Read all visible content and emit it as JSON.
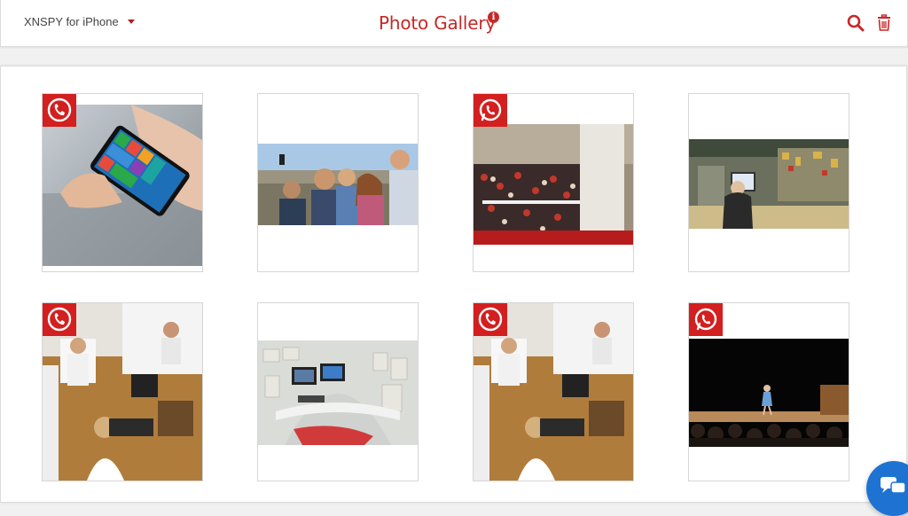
{
  "header": {
    "device_label": "XNSPY for iPhone",
    "title": "Photo Gallery",
    "info_glyph": "i",
    "icons": [
      "search-icon",
      "trash-icon",
      "info-icon",
      "dropdown-caret-icon"
    ]
  },
  "colors": {
    "accent": "#c62828",
    "badge": "#d31f1f",
    "chat": "#1e73d2"
  },
  "gallery": {
    "photos": [
      {
        "name": "phone-in-hand",
        "badge": "viber"
      },
      {
        "name": "group-selfie",
        "badge": "none"
      },
      {
        "name": "crowd-in-mall",
        "badge": "whatsapp"
      },
      {
        "name": "office-cubicle",
        "badge": "none"
      },
      {
        "name": "office-workers",
        "badge": "viber"
      },
      {
        "name": "fisheye-cubicle",
        "badge": "none"
      },
      {
        "name": "office-workers",
        "badge": "viber"
      },
      {
        "name": "stage-performance",
        "badge": "whatsapp"
      }
    ]
  },
  "chat_widget": {
    "icon": "chat-bubbles-icon"
  }
}
